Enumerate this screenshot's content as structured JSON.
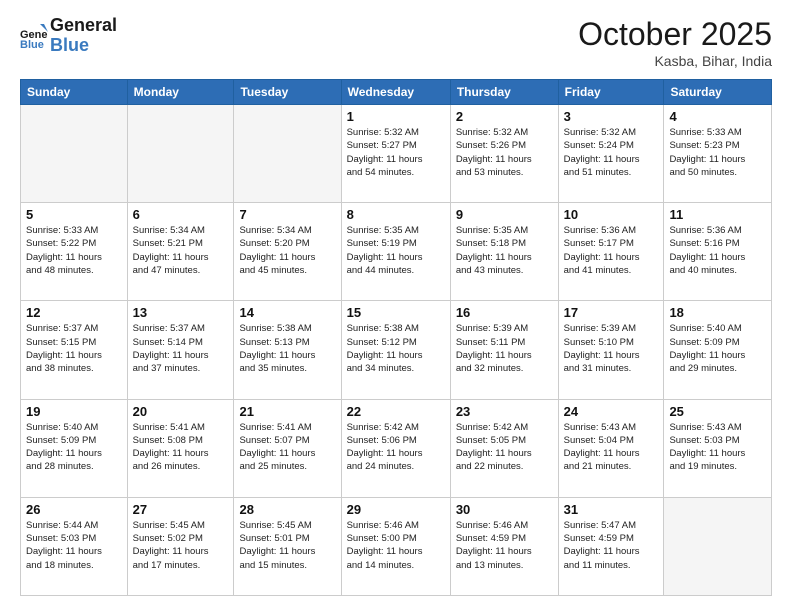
{
  "header": {
    "logo_line1": "General",
    "logo_line2": "Blue",
    "month_title": "October 2025",
    "location": "Kasba, Bihar, India"
  },
  "days_of_week": [
    "Sunday",
    "Monday",
    "Tuesday",
    "Wednesday",
    "Thursday",
    "Friday",
    "Saturday"
  ],
  "weeks": [
    [
      {
        "day": "",
        "info": ""
      },
      {
        "day": "",
        "info": ""
      },
      {
        "day": "",
        "info": ""
      },
      {
        "day": "1",
        "info": "Sunrise: 5:32 AM\nSunset: 5:27 PM\nDaylight: 11 hours\nand 54 minutes."
      },
      {
        "day": "2",
        "info": "Sunrise: 5:32 AM\nSunset: 5:26 PM\nDaylight: 11 hours\nand 53 minutes."
      },
      {
        "day": "3",
        "info": "Sunrise: 5:32 AM\nSunset: 5:24 PM\nDaylight: 11 hours\nand 51 minutes."
      },
      {
        "day": "4",
        "info": "Sunrise: 5:33 AM\nSunset: 5:23 PM\nDaylight: 11 hours\nand 50 minutes."
      }
    ],
    [
      {
        "day": "5",
        "info": "Sunrise: 5:33 AM\nSunset: 5:22 PM\nDaylight: 11 hours\nand 48 minutes."
      },
      {
        "day": "6",
        "info": "Sunrise: 5:34 AM\nSunset: 5:21 PM\nDaylight: 11 hours\nand 47 minutes."
      },
      {
        "day": "7",
        "info": "Sunrise: 5:34 AM\nSunset: 5:20 PM\nDaylight: 11 hours\nand 45 minutes."
      },
      {
        "day": "8",
        "info": "Sunrise: 5:35 AM\nSunset: 5:19 PM\nDaylight: 11 hours\nand 44 minutes."
      },
      {
        "day": "9",
        "info": "Sunrise: 5:35 AM\nSunset: 5:18 PM\nDaylight: 11 hours\nand 43 minutes."
      },
      {
        "day": "10",
        "info": "Sunrise: 5:36 AM\nSunset: 5:17 PM\nDaylight: 11 hours\nand 41 minutes."
      },
      {
        "day": "11",
        "info": "Sunrise: 5:36 AM\nSunset: 5:16 PM\nDaylight: 11 hours\nand 40 minutes."
      }
    ],
    [
      {
        "day": "12",
        "info": "Sunrise: 5:37 AM\nSunset: 5:15 PM\nDaylight: 11 hours\nand 38 minutes."
      },
      {
        "day": "13",
        "info": "Sunrise: 5:37 AM\nSunset: 5:14 PM\nDaylight: 11 hours\nand 37 minutes."
      },
      {
        "day": "14",
        "info": "Sunrise: 5:38 AM\nSunset: 5:13 PM\nDaylight: 11 hours\nand 35 minutes."
      },
      {
        "day": "15",
        "info": "Sunrise: 5:38 AM\nSunset: 5:12 PM\nDaylight: 11 hours\nand 34 minutes."
      },
      {
        "day": "16",
        "info": "Sunrise: 5:39 AM\nSunset: 5:11 PM\nDaylight: 11 hours\nand 32 minutes."
      },
      {
        "day": "17",
        "info": "Sunrise: 5:39 AM\nSunset: 5:10 PM\nDaylight: 11 hours\nand 31 minutes."
      },
      {
        "day": "18",
        "info": "Sunrise: 5:40 AM\nSunset: 5:09 PM\nDaylight: 11 hours\nand 29 minutes."
      }
    ],
    [
      {
        "day": "19",
        "info": "Sunrise: 5:40 AM\nSunset: 5:09 PM\nDaylight: 11 hours\nand 28 minutes."
      },
      {
        "day": "20",
        "info": "Sunrise: 5:41 AM\nSunset: 5:08 PM\nDaylight: 11 hours\nand 26 minutes."
      },
      {
        "day": "21",
        "info": "Sunrise: 5:41 AM\nSunset: 5:07 PM\nDaylight: 11 hours\nand 25 minutes."
      },
      {
        "day": "22",
        "info": "Sunrise: 5:42 AM\nSunset: 5:06 PM\nDaylight: 11 hours\nand 24 minutes."
      },
      {
        "day": "23",
        "info": "Sunrise: 5:42 AM\nSunset: 5:05 PM\nDaylight: 11 hours\nand 22 minutes."
      },
      {
        "day": "24",
        "info": "Sunrise: 5:43 AM\nSunset: 5:04 PM\nDaylight: 11 hours\nand 21 minutes."
      },
      {
        "day": "25",
        "info": "Sunrise: 5:43 AM\nSunset: 5:03 PM\nDaylight: 11 hours\nand 19 minutes."
      }
    ],
    [
      {
        "day": "26",
        "info": "Sunrise: 5:44 AM\nSunset: 5:03 PM\nDaylight: 11 hours\nand 18 minutes."
      },
      {
        "day": "27",
        "info": "Sunrise: 5:45 AM\nSunset: 5:02 PM\nDaylight: 11 hours\nand 17 minutes."
      },
      {
        "day": "28",
        "info": "Sunrise: 5:45 AM\nSunset: 5:01 PM\nDaylight: 11 hours\nand 15 minutes."
      },
      {
        "day": "29",
        "info": "Sunrise: 5:46 AM\nSunset: 5:00 PM\nDaylight: 11 hours\nand 14 minutes."
      },
      {
        "day": "30",
        "info": "Sunrise: 5:46 AM\nSunset: 4:59 PM\nDaylight: 11 hours\nand 13 minutes."
      },
      {
        "day": "31",
        "info": "Sunrise: 5:47 AM\nSunset: 4:59 PM\nDaylight: 11 hours\nand 11 minutes."
      },
      {
        "day": "",
        "info": ""
      }
    ]
  ]
}
